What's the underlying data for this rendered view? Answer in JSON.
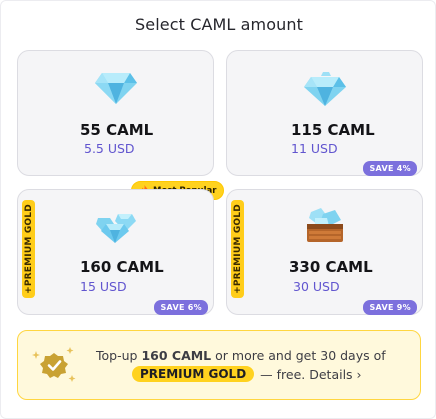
{
  "dialog": {
    "title": "Select CAML amount"
  },
  "packages": [
    {
      "amount": "55 CAML",
      "price": "5.5 USD",
      "save": "",
      "gem_icon": "diamond-icon"
    },
    {
      "amount": "115 CAML",
      "price": "11 USD",
      "save": "SAVE 4%",
      "gem_icon": "diamond-icon"
    },
    {
      "amount": "160 CAML",
      "price": "15 USD",
      "save": "SAVE 6%",
      "gold": "+PREMIUM GOLD",
      "tag": "Most Popular",
      "gem_icon": "diamond-cluster-icon"
    },
    {
      "amount": "330 CAML",
      "price": "30 USD",
      "save": "SAVE 9%",
      "gold": "+PREMIUM GOLD",
      "gem_icon": "diamond-crate-icon"
    }
  ],
  "promo": {
    "prefix": "Top-up",
    "amount": "160 CAML",
    "middle": "or more and get 30 days of",
    "badge": "PREMIUM GOLD",
    "suffix": "— free. Details ›",
    "icon": "verified-badge-icon"
  },
  "colors": {
    "accent": "#6155cf",
    "save_badge": "#7c70dd",
    "gold": "#ffcd1a",
    "promo_bg": "#fff9dc",
    "card_bg": "#f5f5f7"
  }
}
